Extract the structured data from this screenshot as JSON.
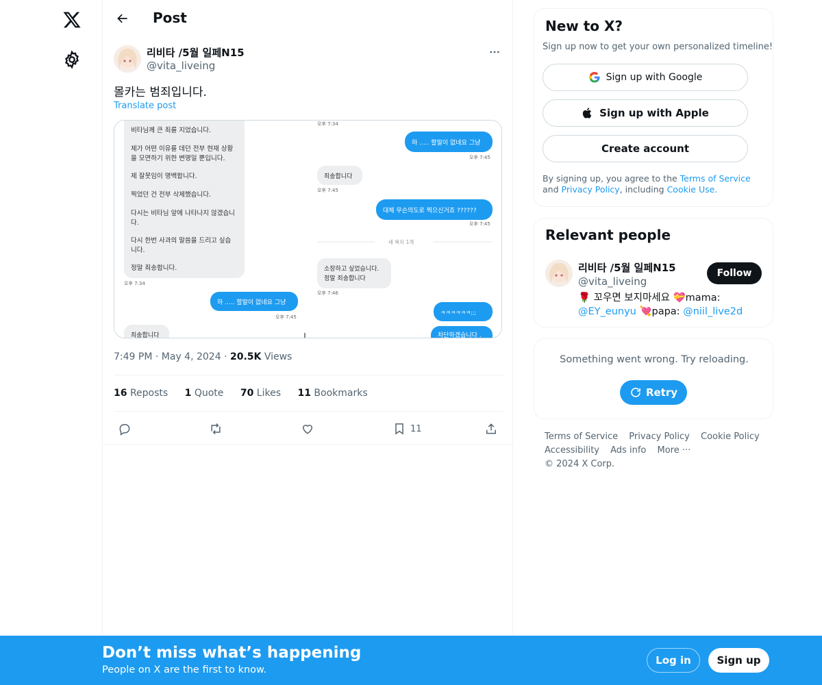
{
  "colors": {
    "accent": "#1d9bf0",
    "text": "#0f1419",
    "muted": "#536471",
    "border": "#eff3f4"
  },
  "nav": {
    "logo_icon": "x-logo-icon",
    "settings_icon": "gear-icon"
  },
  "header": {
    "title": "Post"
  },
  "post": {
    "author_name": "리비타 /5월 일페N15",
    "author_handle": "@vita_liveing",
    "text": "몰카는 범죄입니다.",
    "translate_label": "Translate post",
    "time": "7:49 PM",
    "date": "May 4, 2024",
    "views_count": "20.5K",
    "views_label": "Views",
    "stats": {
      "reposts_count": "16",
      "reposts_label": "Reposts",
      "quote_count": "1",
      "quote_label": "Quote",
      "likes_count": "70",
      "likes_label": "Likes",
      "bookmarks_count": "11",
      "bookmarks_label": "Bookmarks"
    },
    "bookmark_action_count": "11"
  },
  "screenshot_chat": {
    "left_block_lines": [
      "비타님께 큰 죄를 지었습니다.",
      "제가 어떤 이유를 데던 전부 현재 상황",
      "을 모면하기 위한 변명일 뿐입니다.",
      "제 잘못임이 명백합니다.",
      "찍었던 건 전부 삭제했습니다.",
      "다시는 비타님 앞에 나타나지 않겠습니",
      "다.",
      "다시 한번 사과의 말씀을 드리고 싶습",
      "니다.",
      "정말 죄송합니다."
    ],
    "left_time": "오후 7:34",
    "top_time": "오후 7:34",
    "bubble1": "하 ..... 할말이 없네요 그냥",
    "time_745": "오후 7:45",
    "bubble_sorry": "죄송합니다",
    "bubble_why": "대체 무슨의도로 찍으신거죠 ??????",
    "read_marker": "새 목지 1개",
    "bubble_keep": "소장하고 싶었습니다.",
    "bubble_keep2": "정말 죄송합니다",
    "time_746": "오후 7:46",
    "bubble_laugh": "ㅋㅋㅋㅋㅋㅋ;;;",
    "bubble_block": "차단하겠습니다 .",
    "bubble2": "하 ..... 할말이 없네요 그냥",
    "bubble_sorry2": "죄송합니다"
  },
  "signup_card": {
    "title": "New to X?",
    "subtitle": "Sign up now to get your own personalized timeline!",
    "google_label": "Sign up with Google",
    "apple_label": "Sign up with Apple",
    "create_label": "Create account",
    "legal_prefix": "By signing up, you agree to the",
    "terms_label": "Terms of Service",
    "and_label": "and",
    "privacy_label": "Privacy Policy",
    "including_label": ", including",
    "cookie_label": "Cookie Use."
  },
  "relevant_people": {
    "title": "Relevant people",
    "name": "리비타 /5월 일페N15",
    "handle": "@vita_liveing",
    "follow_label": "Follow",
    "bio_part1": "🌹 꼬우면 보지마세요 💝mama:",
    "bio_mention1": "@EY_eunyu",
    "bio_part2": "💘papa:",
    "bio_mention2": "@niil_live2d"
  },
  "error_card": {
    "text": "Something went wrong. Try reloading.",
    "retry_label": "Retry"
  },
  "footer": {
    "links": [
      "Terms of Service",
      "Privacy Policy",
      "Cookie Policy",
      "Accessibility",
      "Ads info",
      "More ···",
      "© 2024 X Corp."
    ]
  },
  "banner": {
    "title": "Don’t miss what’s happening",
    "subtitle": "People on X are the first to know.",
    "login_label": "Log in",
    "signup_label": "Sign up"
  }
}
